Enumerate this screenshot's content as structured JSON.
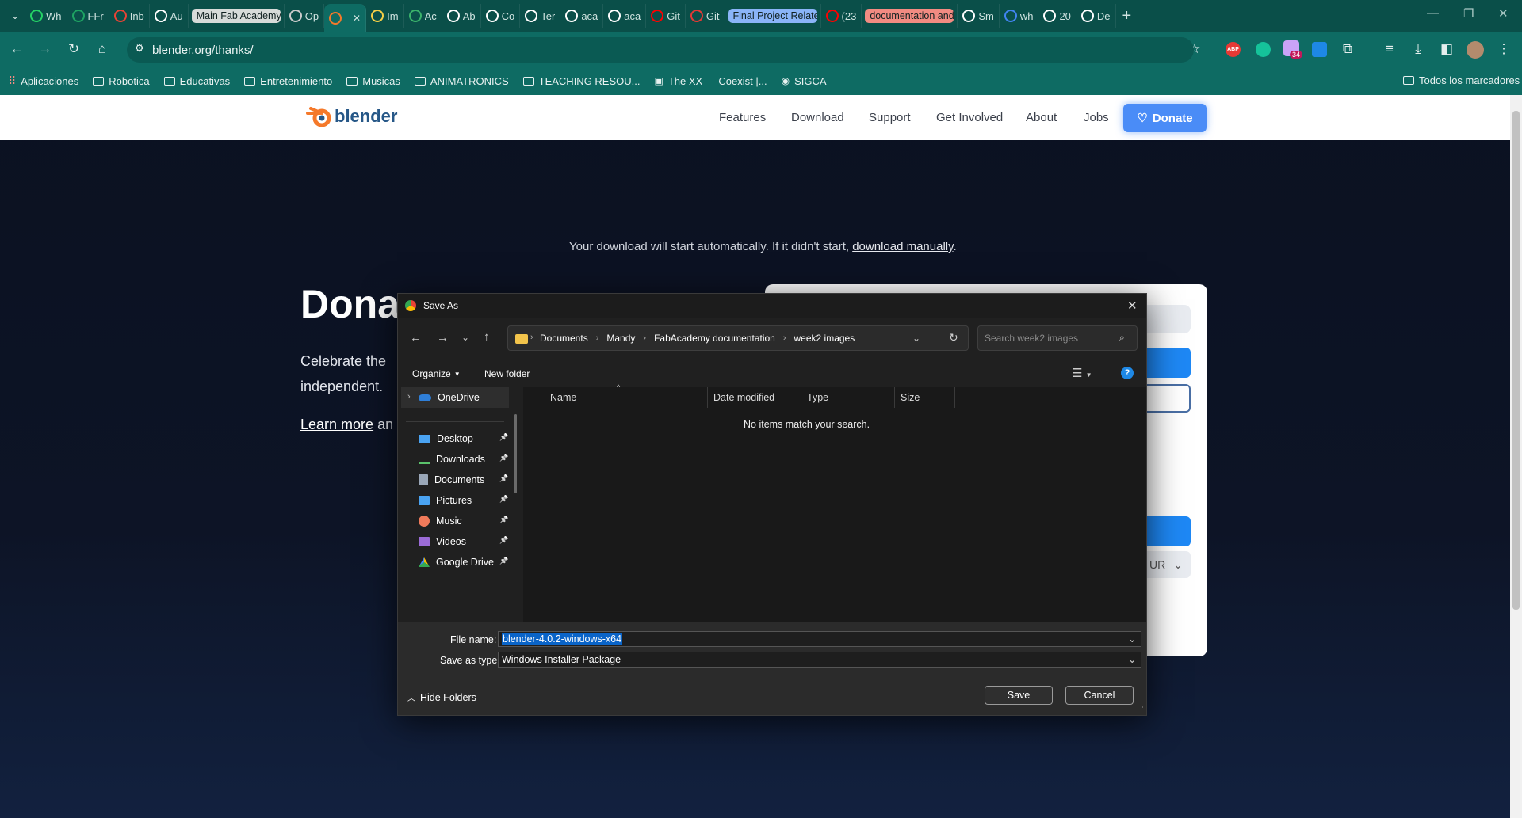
{
  "browser": {
    "tabs": [
      {
        "label": "Wh",
        "icon": "whatsapp-icon",
        "color": "#25d366"
      },
      {
        "label": "FFr",
        "icon": "sheets-icon",
        "color": "#1fa463"
      },
      {
        "label": "Inb",
        "icon": "gmail-icon",
        "color": "#ea4335"
      },
      {
        "label": "Au",
        "icon": "autodesk-icon",
        "color": "#ffffff"
      },
      {
        "label": "Main Fab Academy",
        "icon": "tab-group-chip",
        "color": "#d7dbd9"
      },
      {
        "label": "Op",
        "icon": "openai-icon",
        "color": "#cccccc"
      },
      {
        "label": "",
        "icon": "blender-icon",
        "color": "#f5792a"
      },
      {
        "label": "Im",
        "icon": "star-icon",
        "color": "#f7d046"
      },
      {
        "label": "Ac",
        "icon": "green-leaf-icon",
        "color": "#3bb36b"
      },
      {
        "label": "Ab",
        "icon": "image-icon",
        "color": "#ffffff"
      },
      {
        "label": "Co",
        "icon": "book-icon",
        "color": "#ffffff"
      },
      {
        "label": "Ter",
        "icon": "book-icon",
        "color": "#ffffff"
      },
      {
        "label": "aca",
        "icon": "globe-icon",
        "color": "#ffffff"
      },
      {
        "label": "aca",
        "icon": "globe-icon",
        "color": "#ffffff"
      },
      {
        "label": "Git",
        "icon": "youtube-icon",
        "color": "#ff0000"
      },
      {
        "label": "Git",
        "icon": "pdf-icon",
        "color": "#e53935"
      },
      {
        "label": "Final Project Related",
        "icon": "tab-group-chip",
        "color": "#8ab4f8"
      },
      {
        "label": "(23",
        "icon": "youtube-icon",
        "color": "#ff0000"
      },
      {
        "label": "documentation and m",
        "icon": "tab-group-chip",
        "color": "#f28b82"
      },
      {
        "label": "Sm",
        "icon": "sm-icon",
        "color": "#ffffff"
      },
      {
        "label": "wh",
        "icon": "google-icon",
        "color": "#4285f4"
      },
      {
        "label": "20",
        "icon": "doc-icon",
        "color": "#ffffff"
      },
      {
        "label": "De",
        "icon": "download-icon",
        "color": "#ffffff"
      }
    ],
    "url": "blender.org/thanks/",
    "bookmarks": [
      {
        "label": "Aplicaciones",
        "icon": "apps-grid-icon"
      },
      {
        "label": "Robotica",
        "icon": "folder-icon"
      },
      {
        "label": "Educativas",
        "icon": "folder-icon"
      },
      {
        "label": "Entretenimiento",
        "icon": "folder-icon"
      },
      {
        "label": "Musicas",
        "icon": "folder-icon"
      },
      {
        "label": "ANIMATRONICS",
        "icon": "folder-icon"
      },
      {
        "label": "TEACHING RESOU...",
        "icon": "folder-icon"
      },
      {
        "label": "The XX — Coexist |...",
        "icon": "bookmark-page-icon"
      },
      {
        "label": "SIGCA",
        "icon": "globe-icon"
      }
    ],
    "all_bookmarks": "Todos los marcadores",
    "extension_badge": "34"
  },
  "site": {
    "logo_text": "blender",
    "nav": [
      "Features",
      "Download",
      "Support",
      "Get Involved",
      "About",
      "Jobs"
    ],
    "donate_label": "Donate",
    "download_notice_prefix": "Your download will start automatically. If it didn't start, ",
    "download_link": "download manually",
    "download_notice_suffix": ".",
    "hero_title": "Dona",
    "hero_line1": "Celebrate the",
    "hero_line2": "independent.",
    "learn_more": "Learn more",
    "learn_more_suffix": " an",
    "currency_partial": "UR"
  },
  "dialog": {
    "title": "Save As",
    "breadcrumbs": [
      "Documents",
      "Mandy",
      "FabAcademy documentation",
      "week2 images"
    ],
    "search_placeholder": "Search week2 images",
    "organize": "Organize",
    "new_folder": "New folder",
    "nav_items": [
      {
        "label": "OneDrive",
        "icon": "onedrive-icon",
        "pinned": false
      },
      {
        "label": "Desktop",
        "icon": "desktop-icon",
        "pinned": true
      },
      {
        "label": "Downloads",
        "icon": "downloads-icon",
        "pinned": true
      },
      {
        "label": "Documents",
        "icon": "documents-icon",
        "pinned": true
      },
      {
        "label": "Pictures",
        "icon": "pictures-icon",
        "pinned": true
      },
      {
        "label": "Music",
        "icon": "music-icon",
        "pinned": true
      },
      {
        "label": "Videos",
        "icon": "videos-icon",
        "pinned": true
      },
      {
        "label": "Google Drive",
        "icon": "google-drive-icon",
        "pinned": true
      }
    ],
    "columns": [
      "Name",
      "Date modified",
      "Type",
      "Size"
    ],
    "empty_message": "No items match your search.",
    "file_name_label": "File name:",
    "file_name_value": "blender-4.0.2-windows-x64",
    "save_type_label": "Save as type:",
    "save_type_value": "Windows Installer Package",
    "hide_folders": "Hide Folders",
    "save": "Save",
    "cancel": "Cancel"
  }
}
